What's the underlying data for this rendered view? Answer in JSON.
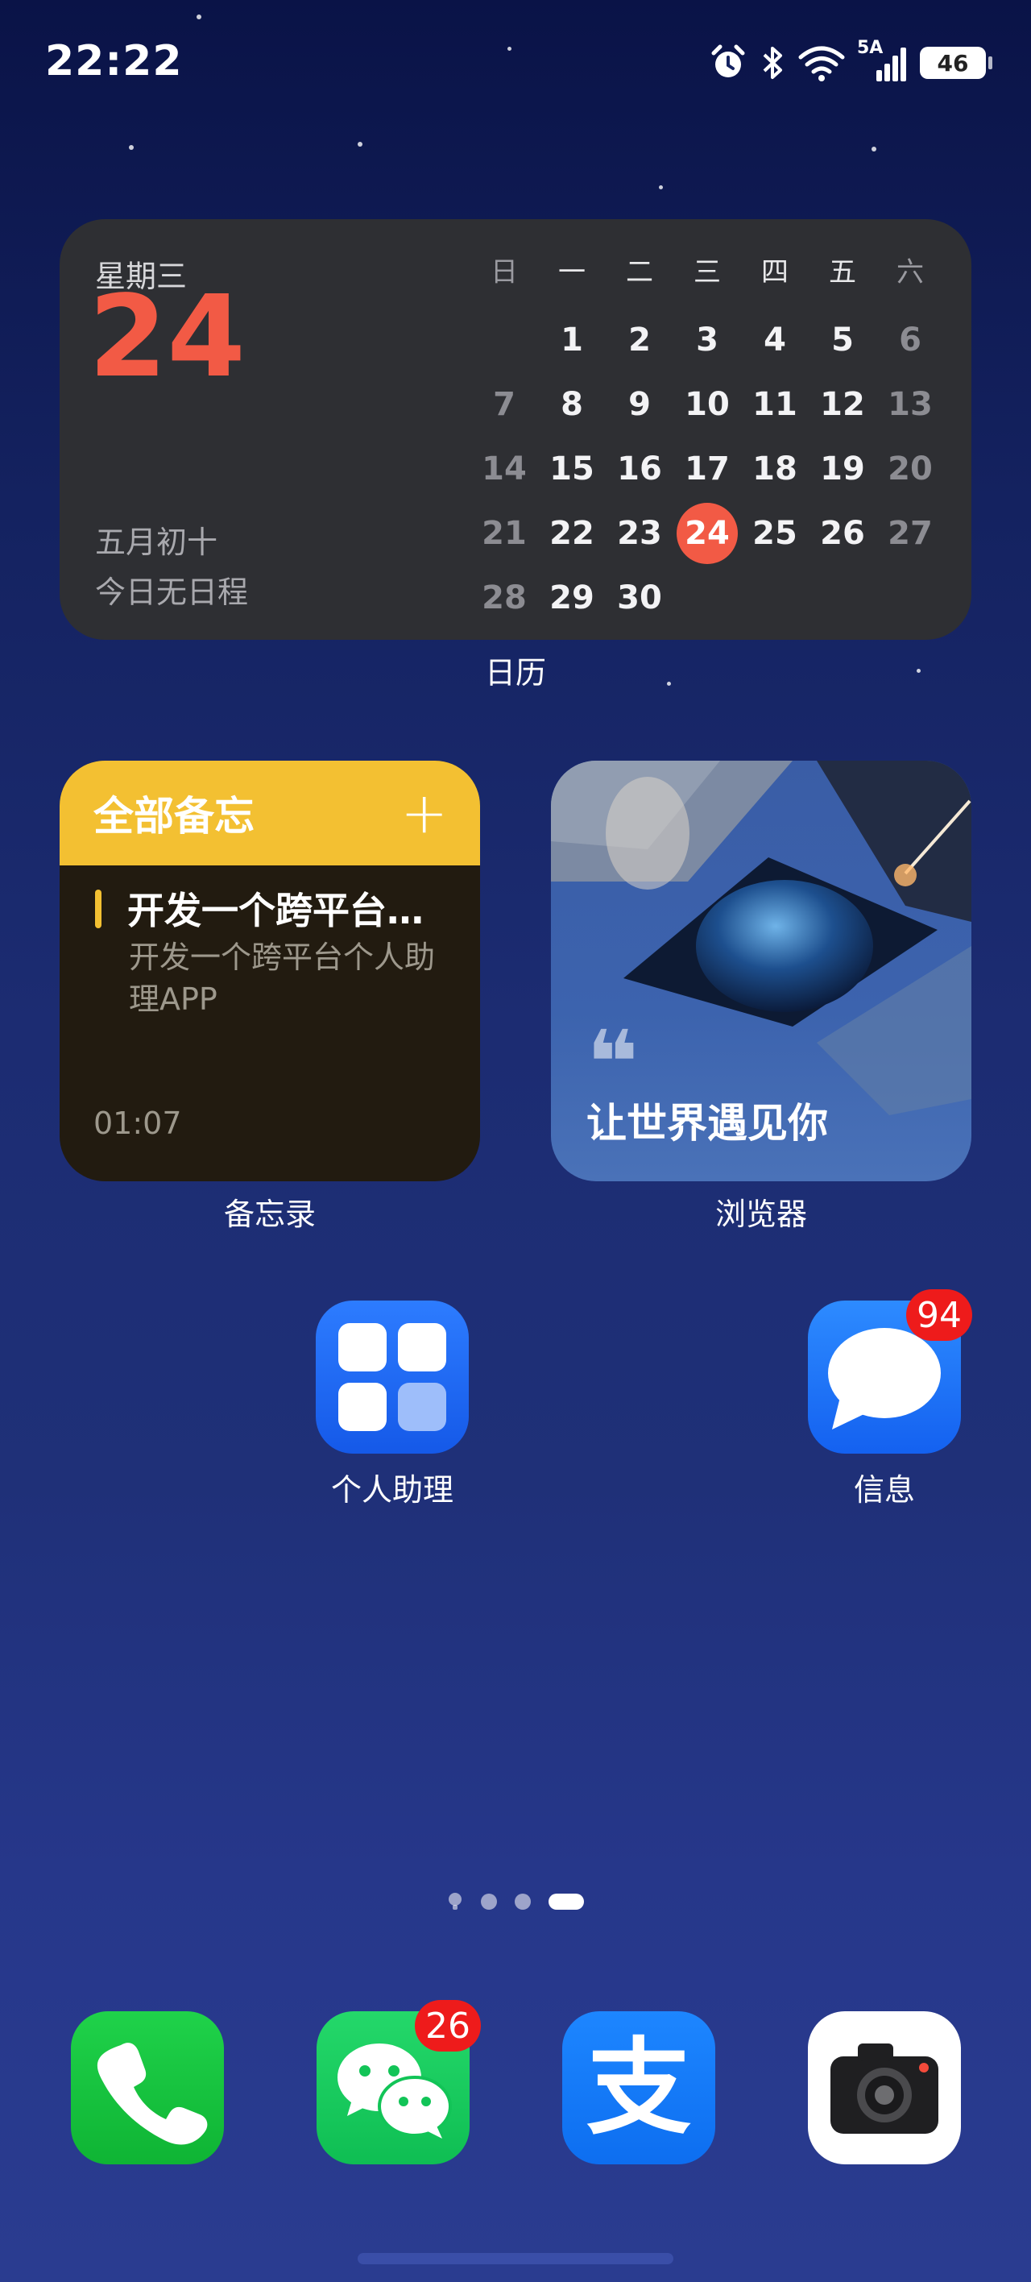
{
  "status_bar": {
    "time": "22:22",
    "network": "5A",
    "battery": "46",
    "icons": [
      "alarm-icon",
      "bluetooth-icon",
      "wifi-icon",
      "signal-icon",
      "battery-icon"
    ]
  },
  "calendar_widget": {
    "weekday": "星期三",
    "day": "24",
    "lunar": "五月初十",
    "schedule": "今日无日程",
    "label": "日历",
    "week_headers": [
      "日",
      "一",
      "二",
      "三",
      "四",
      "五",
      "六"
    ],
    "today": "24",
    "rows": [
      [
        "",
        "1",
        "2",
        "3",
        "4",
        "5",
        "6"
      ],
      [
        "7",
        "8",
        "9",
        "10",
        "11",
        "12",
        "13"
      ],
      [
        "14",
        "15",
        "16",
        "17",
        "18",
        "19",
        "20"
      ],
      [
        "21",
        "22",
        "23",
        "24",
        "25",
        "26",
        "27"
      ],
      [
        "28",
        "29",
        "30",
        "",
        "",
        "",
        ""
      ]
    ],
    "accent_color": "#f25a45"
  },
  "notes_widget": {
    "title": "全部备忘",
    "add_label": "+",
    "item_title": "开发一个跨平台…",
    "item_body": "开发一个跨平台个人助理APP",
    "time": "01:07",
    "label": "备忘录",
    "accent_color": "#f3c032"
  },
  "browser_widget": {
    "quote_mark": "❝",
    "slogan": "让世界遇见你",
    "label": "浏览器"
  },
  "apps": {
    "assistant": {
      "label": "个人助理"
    },
    "messages": {
      "label": "信息",
      "badge": "94"
    }
  },
  "dock": {
    "phone": {
      "icon": "phone-icon"
    },
    "wechat": {
      "icon": "wechat-icon",
      "badge": "26"
    },
    "alipay": {
      "icon": "alipay-icon",
      "glyph": "支"
    },
    "camera": {
      "icon": "camera-icon"
    }
  }
}
